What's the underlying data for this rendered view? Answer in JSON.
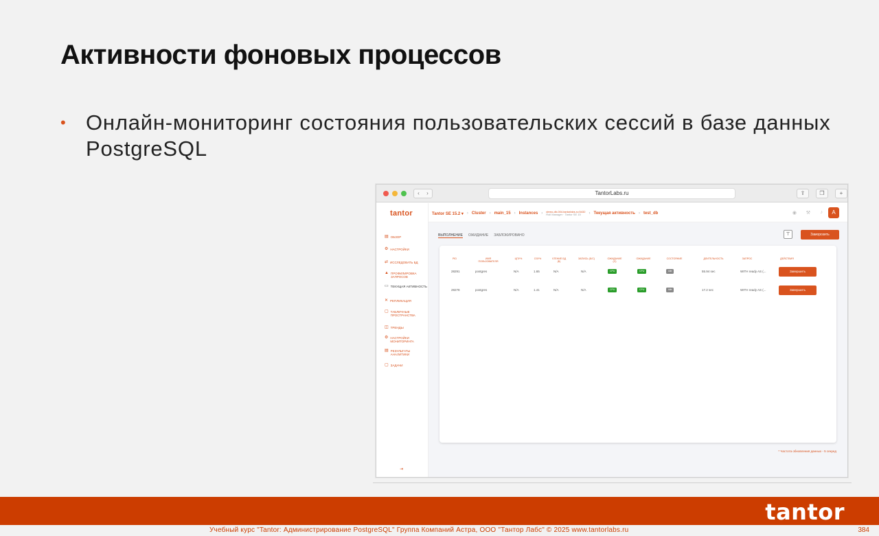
{
  "slide": {
    "title": "Активности фоновых процессов",
    "bullet": "Онлайн-мониторинг состояния пользовательских сессий в базе данных PostgreSQL"
  },
  "browser": {
    "url": "TantorLabs.ru",
    "back": "‹",
    "forward": "›",
    "share_icon": "share-icon",
    "tabs_icon": "tabs-icon",
    "new_tab": "+"
  },
  "app": {
    "logo": "tantor",
    "sidebar": [
      {
        "icon": "▤",
        "label": "ОБЗОР"
      },
      {
        "icon": "⚙",
        "label": "НАСТРОЙКИ"
      },
      {
        "icon": "⇄",
        "label": "ИССЛЕДОВАТЬ БД"
      },
      {
        "icon": "▲",
        "label": "ПРОФИЛИРОВКА ЗАПРОСОВ"
      },
      {
        "icon": "▭",
        "label": "ТЕКУЩАЯ АКТИВНОСТЬ"
      },
      {
        "icon": "✕",
        "label": "РЕПЛИКАЦИЯ"
      },
      {
        "icon": "▢",
        "label": "ТАБЛИЧНЫЕ ПРОСТРАНСТВА"
      },
      {
        "icon": "◫",
        "label": "ТРЕНДЫ"
      },
      {
        "icon": "⚙",
        "label": "НАСТРОЙКИ МОНИТОРИНГА"
      },
      {
        "icon": "▤",
        "label": "РЕЗУЛЬТАТЫ АНАЛИТИКИ"
      },
      {
        "icon": "▢",
        "label": "ЗАДАЧИ"
      }
    ],
    "collapse": "⇥",
    "breadcrumbs": [
      {
        "label": "Tantor SE 15.2 ▾"
      },
      {
        "label": "Cluster"
      },
      {
        "label": "main_15"
      },
      {
        "label": "Instances"
      },
      {
        "label": "demo-db-004.tantorlabs.ru:5432",
        "sub": "Roll Manager · Tantor SE 15"
      },
      {
        "label": "Текущая активность"
      },
      {
        "label": "test_db"
      }
    ],
    "user_initial": "А",
    "tabs": [
      "ВЫПОЛНЕНИЕ",
      "ОЖИДАНИЕ",
      "ЗАБЛОКИРОВАНО"
    ],
    "freeze_label": "Заморозить",
    "filter_icon": "filter-icon",
    "table": {
      "headers": [
        "PID",
        "ИМЯ ПОЛЬЗОВАТЕЛЯ",
        "ЦПУ%",
        "ОЗУ%",
        "ЧТЕНИЕ БД (Б)",
        "ЗАПИСЬ (Б/С)",
        "ОЖИДАНИЕ (С)",
        "ОЖИДАНИЕ",
        "СОСТОЯНИЕ",
        "ДЛИТЕЛЬНОСТЬ",
        "ЗАПРОС",
        "ДЕЙСТВИЯ"
      ],
      "rows": [
        {
          "pid": "28291",
          "user": "postgres",
          "cpu": "N/A",
          "mem": "1.65",
          "read": "N/A",
          "write": "N/A",
          "wait_s": "CPU",
          "wait": "CPU",
          "state": "idle",
          "duration": "55.94 sec",
          "query": "WITH ready AS (...",
          "action": "Завершить"
        },
        {
          "pid": "28278",
          "user": "postgres",
          "cpu": "N/A",
          "mem": "1.41",
          "read": "N/A",
          "write": "N/A",
          "wait_s": "CPU",
          "wait": "CPU",
          "state": "idle",
          "duration": "17.2 sec",
          "query": "WITH ready AS (...",
          "action": "Завершить"
        }
      ]
    },
    "footnote": "* Частота обновления данных - 5 секунд"
  },
  "footer": {
    "logo": "tantor",
    "text": "Учебный курс \"Tantor: Администрирование PostgreSQL\" Группа Компаний Астра, ООО \"Тантор Лабс\" © 2025  www.tantorlabs.ru",
    "page": "384"
  },
  "colors": {
    "accent": "#cc3d00",
    "app_accent": "#d9531e",
    "status_green": "#2a9d2a"
  }
}
